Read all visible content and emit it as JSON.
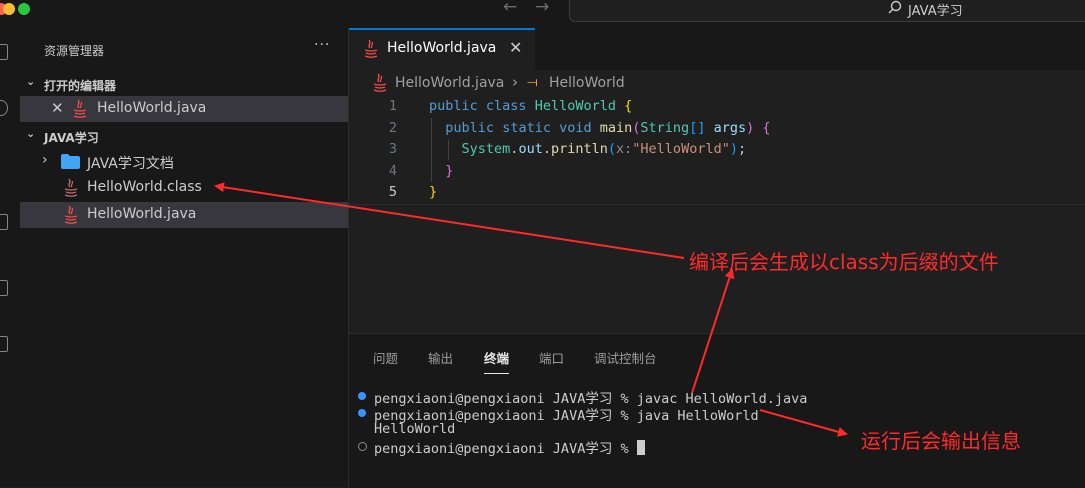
{
  "titlebar": {
    "traffic_colors": [
      "#ff5f57",
      "#febc2e",
      "#28c840"
    ],
    "search_label": "JAVA学习"
  },
  "sidebar": {
    "title": "资源管理器",
    "more_label": "···",
    "open_editors": {
      "header": "打开的编辑器",
      "items": [
        {
          "label": "HelloWorld.java"
        }
      ]
    },
    "folder": {
      "header": "JAVA学习",
      "items": [
        {
          "label": "JAVA学习文档",
          "type": "folder"
        },
        {
          "label": "HelloWorld.class",
          "type": "file"
        },
        {
          "label": "HelloWorld.java",
          "type": "file",
          "selected": true
        }
      ]
    }
  },
  "editor": {
    "tab_label": "HelloWorld.java",
    "breadcrumb": {
      "file": "HelloWorld.java",
      "symbol": "HelloWorld"
    },
    "line_numbers": [
      "1",
      "2",
      "3",
      "4",
      "5"
    ],
    "code_lines": [
      "public class HelloWorld {",
      "  public static void main(String[] args) {",
      "    System.out.println(x:\"HelloWorld\");",
      "  }",
      "}"
    ]
  },
  "panel": {
    "tabs": [
      "问题",
      "输出",
      "终端",
      "端口",
      "调试控制台"
    ],
    "active_tab": "终端",
    "terminal_lines": [
      "pengxiaoni@pengxiaoni JAVA学习 % javac HelloWorld.java",
      "pengxiaoni@pengxiaoni JAVA学习 % java HelloWorld",
      "HelloWorld",
      "pengxiaoni@pengxiaoni JAVA学习 % "
    ]
  },
  "annotations": {
    "class_note": "编译后会生成以class为后缀的文件",
    "run_note": "运行后会输出信息",
    "color": "#ff2a2a"
  }
}
